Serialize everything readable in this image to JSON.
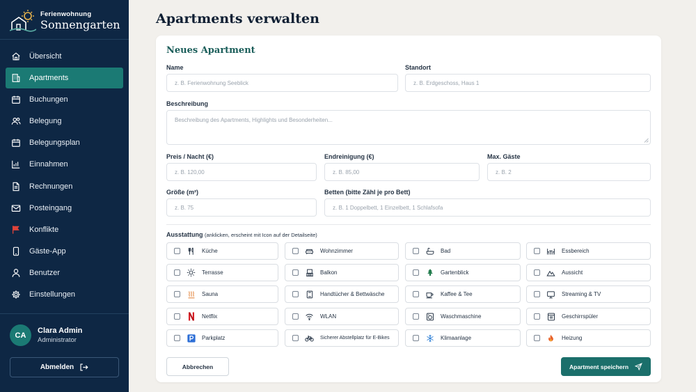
{
  "brand": {
    "small": "Ferienwohnung",
    "big": "Sonnengarten"
  },
  "nav": [
    {
      "label": "Übersicht",
      "icon": "home-icon"
    },
    {
      "label": "Apartments",
      "icon": "building-icon",
      "active": true
    },
    {
      "label": "Buchungen",
      "icon": "calendar-icon"
    },
    {
      "label": "Belegung",
      "icon": "users-icon"
    },
    {
      "label": "Belegungsplan",
      "icon": "calendar-icon"
    },
    {
      "label": "Einnahmen",
      "icon": "chart-icon"
    },
    {
      "label": "Rechnungen",
      "icon": "document-icon"
    },
    {
      "label": "Posteingang",
      "icon": "mail-icon"
    },
    {
      "label": "Konflikte",
      "icon": "flag-icon"
    },
    {
      "label": "Gäste-App",
      "icon": "phone-icon"
    },
    {
      "label": "Benutzer",
      "icon": "user-icon"
    },
    {
      "label": "Einstellungen",
      "icon": "gear-icon"
    }
  ],
  "user": {
    "initials": "CA",
    "name": "Clara Admin",
    "role": "Administrator"
  },
  "logout_label": "Abmelden",
  "page_title": "Apartments verwalten",
  "form": {
    "title": "Neues Apartment",
    "name": {
      "label": "Name",
      "placeholder": "z. B. Ferienwohnung Seeblick"
    },
    "location": {
      "label": "Standort",
      "placeholder": "z. B. Erdgeschoss, Haus 1"
    },
    "description": {
      "label": "Beschreibung",
      "placeholder": "Beschreibung des Apartments, Highlights und Besonderheiten..."
    },
    "price": {
      "label": "Preis / Nacht (€)",
      "placeholder": "z. B. 120,00"
    },
    "cleaning": {
      "label": "Endreinigung (€)",
      "placeholder": "z. B. 85,00"
    },
    "guests": {
      "label": "Max. Gäste",
      "placeholder": "z. B. 2"
    },
    "size": {
      "label": "Größe (m²)",
      "placeholder": "z. B. 75"
    },
    "beds": {
      "label": "Betten (bitte Zähl je pro Bett)",
      "placeholder": "z. B. 1 Doppelbett, 1 Einzelbett, 1 Schlafsofa"
    },
    "amenities_label": "Ausstattung",
    "amenities_hint": "(anklicken, erscheint mit Icon auf der Detailseite)",
    "amenities": [
      {
        "label": "Küche",
        "icon": "cutlery-icon"
      },
      {
        "label": "Wohnzimmer",
        "icon": "sofa-icon"
      },
      {
        "label": "Bad",
        "icon": "bath-icon"
      },
      {
        "label": "Essbereich",
        "icon": "dining-icon"
      },
      {
        "label": "Terrasse",
        "icon": "sun-icon"
      },
      {
        "label": "Balkon",
        "icon": "balcony-icon"
      },
      {
        "label": "Gartenblick",
        "icon": "tree-icon"
      },
      {
        "label": "Aussicht",
        "icon": "mountain-icon"
      },
      {
        "label": "Sauna",
        "icon": "sauna-icon"
      },
      {
        "label": "Handtücher & Bettwäsche",
        "icon": "towel-icon"
      },
      {
        "label": "Kaffee & Tee",
        "icon": "coffee-icon"
      },
      {
        "label": "Streaming & TV",
        "icon": "tv-icon"
      },
      {
        "label": "Netflix",
        "icon": "netflix-icon"
      },
      {
        "label": "WLAN",
        "icon": "wifi-icon"
      },
      {
        "label": "Waschmaschine",
        "icon": "washer-icon"
      },
      {
        "label": "Geschirrspüler",
        "icon": "dishwasher-icon"
      },
      {
        "label": "Parkplatz",
        "icon": "parking-icon"
      },
      {
        "label": "Sicherer Abstellplatz für E-Bikes",
        "icon": "bike-icon"
      },
      {
        "label": "Klimaanlage",
        "icon": "snowflake-icon"
      },
      {
        "label": "Heizung",
        "icon": "flame-icon"
      }
    ],
    "cancel_label": "Abbrechen",
    "save_label": "Apartment speichern"
  },
  "colors": {
    "sidebar": "#0e2744",
    "accent": "#1b7a74",
    "save": "#1b6f6b",
    "flag": "#e0433a",
    "netflix": "#d81f26",
    "parking": "#2d6fd6"
  }
}
